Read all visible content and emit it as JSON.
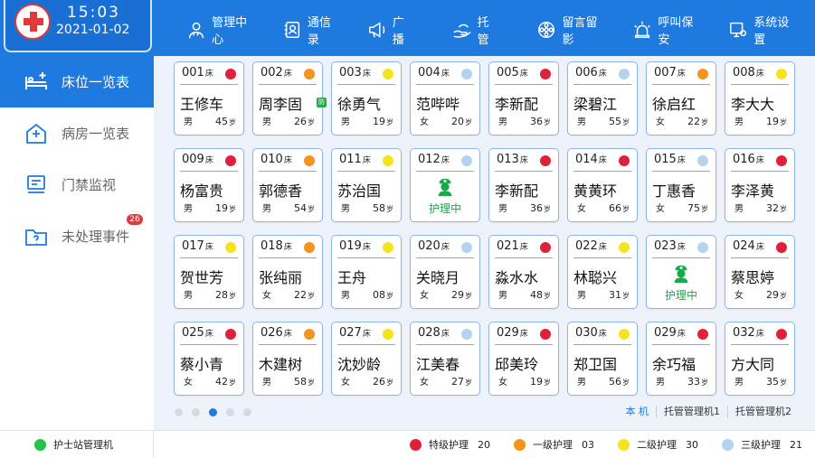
{
  "header": {
    "time": "15:03",
    "date": "2021-01-02",
    "nav": [
      {
        "label": "管理中心",
        "icon": "doctor-icon",
        "active": true
      },
      {
        "label": "通信录",
        "icon": "contacts-icon"
      },
      {
        "label": "广　播",
        "icon": "megaphone-icon"
      },
      {
        "label": "托　管",
        "icon": "hand-icon"
      },
      {
        "label": "留言留影",
        "icon": "camera-reel-icon"
      },
      {
        "label": "呼叫保安",
        "icon": "alarm-icon"
      },
      {
        "label": "系统设置",
        "icon": "settings-icon"
      }
    ]
  },
  "sidebar": {
    "items": [
      {
        "label": "床位一览表",
        "icon": "bed-icon",
        "active": true
      },
      {
        "label": "病房一览表",
        "icon": "ward-icon"
      },
      {
        "label": "门禁监视",
        "icon": "monitor-icon"
      },
      {
        "label": "未处理事件",
        "icon": "folder-icon",
        "badge": "26"
      }
    ]
  },
  "bed_unit": "床",
  "age_unit": "岁",
  "nursing_label": "护理中",
  "tag_text": "防",
  "colors": {
    "special": "#e0203a",
    "first": "#f5941d",
    "second": "#f7e21e",
    "third": "#b5d3ee",
    "accent": "#1f7ae0"
  },
  "beds": [
    {
      "no": "001",
      "level": "special",
      "name": "王修车",
      "sex": "男",
      "age": "45"
    },
    {
      "no": "002",
      "level": "first",
      "name": "周李固",
      "sex": "男",
      "age": "26",
      "tag": true
    },
    {
      "no": "003",
      "level": "second",
      "name": "徐勇气",
      "sex": "男",
      "age": "19"
    },
    {
      "no": "004",
      "level": "third",
      "name": "范哔哔",
      "sex": "女",
      "age": "20"
    },
    {
      "no": "005",
      "level": "special",
      "name": "李新配",
      "sex": "男",
      "age": "36"
    },
    {
      "no": "006",
      "level": "third",
      "name": "梁碧江",
      "sex": "男",
      "age": "55"
    },
    {
      "no": "007",
      "level": "first",
      "name": "徐启红",
      "sex": "女",
      "age": "22"
    },
    {
      "no": "008",
      "level": "second",
      "name": "李大大",
      "sex": "男",
      "age": "19"
    },
    {
      "no": "009",
      "level": "special",
      "name": "杨富贵",
      "sex": "男",
      "age": "19"
    },
    {
      "no": "010",
      "level": "first",
      "name": "郭德香",
      "sex": "男",
      "age": "54"
    },
    {
      "no": "011",
      "level": "second",
      "name": "苏治国",
      "sex": "男",
      "age": "58"
    },
    {
      "no": "012",
      "level": "third",
      "nursing": true
    },
    {
      "no": "013",
      "level": "special",
      "name": "李新配",
      "sex": "男",
      "age": "36"
    },
    {
      "no": "014",
      "level": "special",
      "name": "黄黄环",
      "sex": "女",
      "age": "66"
    },
    {
      "no": "015",
      "level": "third",
      "name": "丁惠香",
      "sex": "女",
      "age": "75"
    },
    {
      "no": "016",
      "level": "special",
      "name": "李泽黄",
      "sex": "男",
      "age": "32"
    },
    {
      "no": "017",
      "level": "second",
      "name": "贺世芳",
      "sex": "男",
      "age": "28"
    },
    {
      "no": "018",
      "level": "first",
      "name": "张纯丽",
      "sex": "女",
      "age": "22"
    },
    {
      "no": "019",
      "level": "second",
      "name": "王舟",
      "sex": "男",
      "age": "08"
    },
    {
      "no": "020",
      "level": "third",
      "name": "关晓月",
      "sex": "女",
      "age": "29"
    },
    {
      "no": "021",
      "level": "special",
      "name": "淼水水",
      "sex": "男",
      "age": "48"
    },
    {
      "no": "022",
      "level": "second",
      "name": "林聪兴",
      "sex": "男",
      "age": "31"
    },
    {
      "no": "023",
      "level": "third",
      "nursing": true
    },
    {
      "no": "024",
      "level": "special",
      "name": "蔡思婷",
      "sex": "女",
      "age": "29"
    },
    {
      "no": "025",
      "level": "special",
      "name": "蔡小青",
      "sex": "女",
      "age": "42"
    },
    {
      "no": "026",
      "level": "first",
      "name": "木建树",
      "sex": "男",
      "age": "58"
    },
    {
      "no": "027",
      "level": "second",
      "name": "沈妙龄",
      "sex": "女",
      "age": "26"
    },
    {
      "no": "028",
      "level": "third",
      "name": "江美春",
      "sex": "女",
      "age": "27"
    },
    {
      "no": "029",
      "level": "special",
      "name": "邱美玲",
      "sex": "女",
      "age": "19"
    },
    {
      "no": "030",
      "level": "second",
      "name": "郑卫国",
      "sex": "男",
      "age": "56"
    },
    {
      "no": "029",
      "level": "special",
      "name": "余巧福",
      "sex": "男",
      "age": "33"
    },
    {
      "no": "032",
      "level": "special",
      "name": "方大同",
      "sex": "男",
      "age": "35"
    }
  ],
  "pagination": {
    "pages": 5,
    "current": 3
  },
  "device_tabs": [
    {
      "label": "本 机",
      "active": true
    },
    {
      "label": "托管管理机1"
    },
    {
      "label": "托管管理机2"
    }
  ],
  "footer": {
    "station": "护士站管理机",
    "legend": [
      {
        "level": "special",
        "label": "特级护理",
        "count": "20"
      },
      {
        "level": "first",
        "label": "一级护理",
        "count": "03"
      },
      {
        "level": "second",
        "label": "二级护理",
        "count": "30"
      },
      {
        "level": "third",
        "label": "三级护理",
        "count": "21"
      }
    ]
  }
}
